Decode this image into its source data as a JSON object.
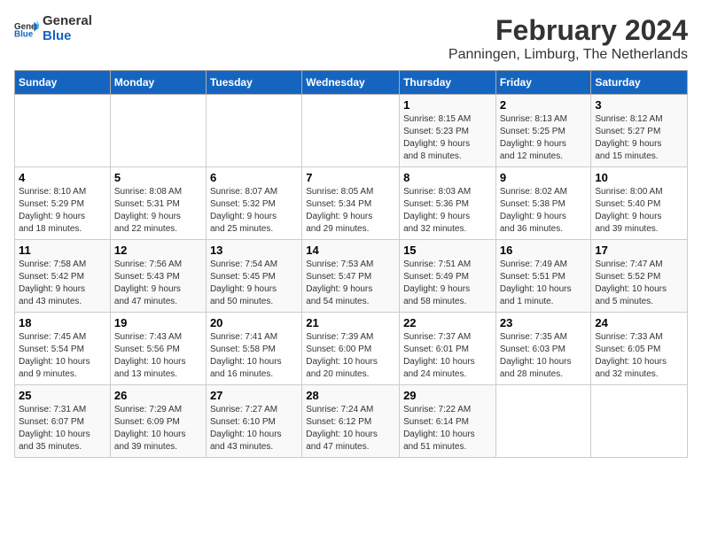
{
  "app": {
    "name_general": "General",
    "name_blue": "Blue"
  },
  "header": {
    "title": "February 2024",
    "subtitle": "Panningen, Limburg, The Netherlands"
  },
  "calendar": {
    "weekdays": [
      "Sunday",
      "Monday",
      "Tuesday",
      "Wednesday",
      "Thursday",
      "Friday",
      "Saturday"
    ],
    "weeks": [
      [
        {
          "day": "",
          "info": ""
        },
        {
          "day": "",
          "info": ""
        },
        {
          "day": "",
          "info": ""
        },
        {
          "day": "",
          "info": ""
        },
        {
          "day": "1",
          "info": "Sunrise: 8:15 AM\nSunset: 5:23 PM\nDaylight: 9 hours\nand 8 minutes."
        },
        {
          "day": "2",
          "info": "Sunrise: 8:13 AM\nSunset: 5:25 PM\nDaylight: 9 hours\nand 12 minutes."
        },
        {
          "day": "3",
          "info": "Sunrise: 8:12 AM\nSunset: 5:27 PM\nDaylight: 9 hours\nand 15 minutes."
        }
      ],
      [
        {
          "day": "4",
          "info": "Sunrise: 8:10 AM\nSunset: 5:29 PM\nDaylight: 9 hours\nand 18 minutes."
        },
        {
          "day": "5",
          "info": "Sunrise: 8:08 AM\nSunset: 5:31 PM\nDaylight: 9 hours\nand 22 minutes."
        },
        {
          "day": "6",
          "info": "Sunrise: 8:07 AM\nSunset: 5:32 PM\nDaylight: 9 hours\nand 25 minutes."
        },
        {
          "day": "7",
          "info": "Sunrise: 8:05 AM\nSunset: 5:34 PM\nDaylight: 9 hours\nand 29 minutes."
        },
        {
          "day": "8",
          "info": "Sunrise: 8:03 AM\nSunset: 5:36 PM\nDaylight: 9 hours\nand 32 minutes."
        },
        {
          "day": "9",
          "info": "Sunrise: 8:02 AM\nSunset: 5:38 PM\nDaylight: 9 hours\nand 36 minutes."
        },
        {
          "day": "10",
          "info": "Sunrise: 8:00 AM\nSunset: 5:40 PM\nDaylight: 9 hours\nand 39 minutes."
        }
      ],
      [
        {
          "day": "11",
          "info": "Sunrise: 7:58 AM\nSunset: 5:42 PM\nDaylight: 9 hours\nand 43 minutes."
        },
        {
          "day": "12",
          "info": "Sunrise: 7:56 AM\nSunset: 5:43 PM\nDaylight: 9 hours\nand 47 minutes."
        },
        {
          "day": "13",
          "info": "Sunrise: 7:54 AM\nSunset: 5:45 PM\nDaylight: 9 hours\nand 50 minutes."
        },
        {
          "day": "14",
          "info": "Sunrise: 7:53 AM\nSunset: 5:47 PM\nDaylight: 9 hours\nand 54 minutes."
        },
        {
          "day": "15",
          "info": "Sunrise: 7:51 AM\nSunset: 5:49 PM\nDaylight: 9 hours\nand 58 minutes."
        },
        {
          "day": "16",
          "info": "Sunrise: 7:49 AM\nSunset: 5:51 PM\nDaylight: 10 hours\nand 1 minute."
        },
        {
          "day": "17",
          "info": "Sunrise: 7:47 AM\nSunset: 5:52 PM\nDaylight: 10 hours\nand 5 minutes."
        }
      ],
      [
        {
          "day": "18",
          "info": "Sunrise: 7:45 AM\nSunset: 5:54 PM\nDaylight: 10 hours\nand 9 minutes."
        },
        {
          "day": "19",
          "info": "Sunrise: 7:43 AM\nSunset: 5:56 PM\nDaylight: 10 hours\nand 13 minutes."
        },
        {
          "day": "20",
          "info": "Sunrise: 7:41 AM\nSunset: 5:58 PM\nDaylight: 10 hours\nand 16 minutes."
        },
        {
          "day": "21",
          "info": "Sunrise: 7:39 AM\nSunset: 6:00 PM\nDaylight: 10 hours\nand 20 minutes."
        },
        {
          "day": "22",
          "info": "Sunrise: 7:37 AM\nSunset: 6:01 PM\nDaylight: 10 hours\nand 24 minutes."
        },
        {
          "day": "23",
          "info": "Sunrise: 7:35 AM\nSunset: 6:03 PM\nDaylight: 10 hours\nand 28 minutes."
        },
        {
          "day": "24",
          "info": "Sunrise: 7:33 AM\nSunset: 6:05 PM\nDaylight: 10 hours\nand 32 minutes."
        }
      ],
      [
        {
          "day": "25",
          "info": "Sunrise: 7:31 AM\nSunset: 6:07 PM\nDaylight: 10 hours\nand 35 minutes."
        },
        {
          "day": "26",
          "info": "Sunrise: 7:29 AM\nSunset: 6:09 PM\nDaylight: 10 hours\nand 39 minutes."
        },
        {
          "day": "27",
          "info": "Sunrise: 7:27 AM\nSunset: 6:10 PM\nDaylight: 10 hours\nand 43 minutes."
        },
        {
          "day": "28",
          "info": "Sunrise: 7:24 AM\nSunset: 6:12 PM\nDaylight: 10 hours\nand 47 minutes."
        },
        {
          "day": "29",
          "info": "Sunrise: 7:22 AM\nSunset: 6:14 PM\nDaylight: 10 hours\nand 51 minutes."
        },
        {
          "day": "",
          "info": ""
        },
        {
          "day": "",
          "info": ""
        }
      ]
    ]
  }
}
